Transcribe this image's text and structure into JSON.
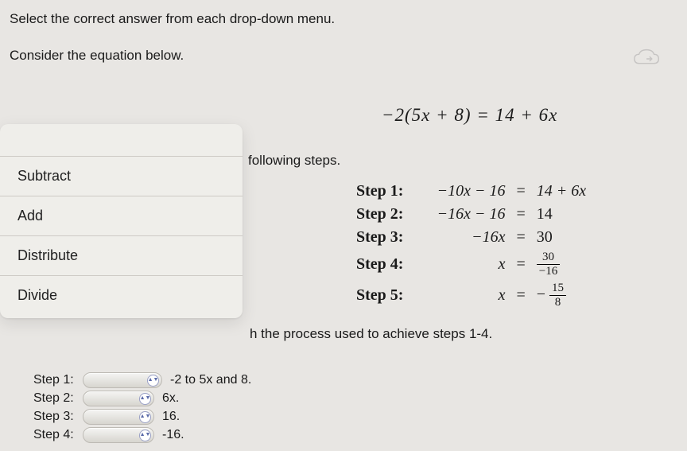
{
  "instruction": "Select the correct answer from each drop-down menu.",
  "consider": "Consider the equation below.",
  "equation_main": "−2(5x + 8) = 14 + 6x",
  "following": "following steps.",
  "steps": [
    {
      "label": "Step 1:",
      "lhs": "−10x − 16",
      "eq": "=",
      "rhs": "14 + 6x"
    },
    {
      "label": "Step 2:",
      "lhs": "−16x − 16",
      "eq": "=",
      "rhs": "14"
    },
    {
      "label": "Step 3:",
      "lhs": "−16x",
      "eq": "=",
      "rhs": "30"
    },
    {
      "label": "Step 4:",
      "lhs": "x",
      "eq": "=",
      "rhs_frac": {
        "num": "30",
        "den": "−16"
      }
    },
    {
      "label": "Step 5:",
      "lhs": "x",
      "eq": "=",
      "rhs_prefix": "− ",
      "rhs_frac": {
        "num": "15",
        "den": "8"
      }
    }
  ],
  "process_text": "h the process used to achieve steps 1-4.",
  "dropdown": {
    "options": [
      "Subtract",
      "Add",
      "Distribute",
      "Divide"
    ]
  },
  "dd_steps": [
    {
      "label": "Step 1:",
      "suffix": "-2 to 5x and 8."
    },
    {
      "label": "Step 2:",
      "suffix": "6x."
    },
    {
      "label": "Step 3:",
      "suffix": "16."
    },
    {
      "label": "Step 4:",
      "suffix": "-16."
    }
  ],
  "icons": {
    "check": "✓"
  }
}
